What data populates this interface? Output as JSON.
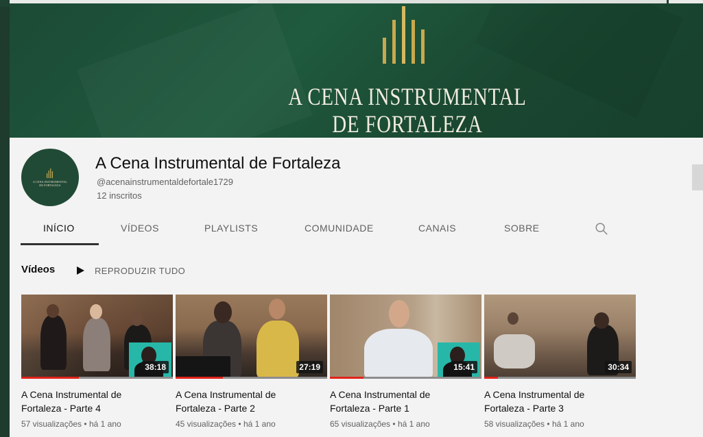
{
  "banner": {
    "title_line1": "A CENA INSTRUMENTAL",
    "title_line2": "DE FORTALEZA",
    "colors": {
      "background": "#1d4d36",
      "logo_gold": "#c9a94f",
      "title": "#f1ece0"
    }
  },
  "avatar": {
    "text_line1": "A CENA INSTRUMENTAL",
    "text_line2": "DE FORTALEZA"
  },
  "channel": {
    "name": "A Cena Instrumental de Fortaleza",
    "handle": "@acenainstrumentaldefortale1729",
    "subscribers": "12 inscritos"
  },
  "tabs": [
    {
      "label": "INÍCIO",
      "active": true
    },
    {
      "label": "VÍDEOS",
      "active": false
    },
    {
      "label": "PLAYLISTS",
      "active": false
    },
    {
      "label": "COMUNIDADE",
      "active": false
    },
    {
      "label": "CANAIS",
      "active": false
    },
    {
      "label": "SOBRE",
      "active": false
    }
  ],
  "search_icon": "search-icon",
  "section": {
    "title": "Vídeos",
    "play_all": "REPRODUZIR TUDO"
  },
  "videos": [
    {
      "title": "A Cena Instrumental de Fortaleza - Parte 4",
      "duration": "38:18",
      "views": "57 visualizações",
      "age": "há 1 ano",
      "watched": 0.38
    },
    {
      "title": "A Cena Instrumental de Fortaleza - Parte 2",
      "duration": "27:19",
      "views": "45 visualizações",
      "age": "há 1 ano",
      "watched": 0.31
    },
    {
      "title": "A Cena Instrumental de Fortaleza - Parte 1",
      "duration": "15:41",
      "views": "65 visualizações",
      "age": "há 1 ano",
      "watched": 0.22
    },
    {
      "title": "A Cena Instrumental de Fortaleza - Parte 3",
      "duration": "30:34",
      "views": "58 visualizações",
      "age": "há 1 ano",
      "watched": 0.09
    }
  ],
  "meta_separator": "•"
}
